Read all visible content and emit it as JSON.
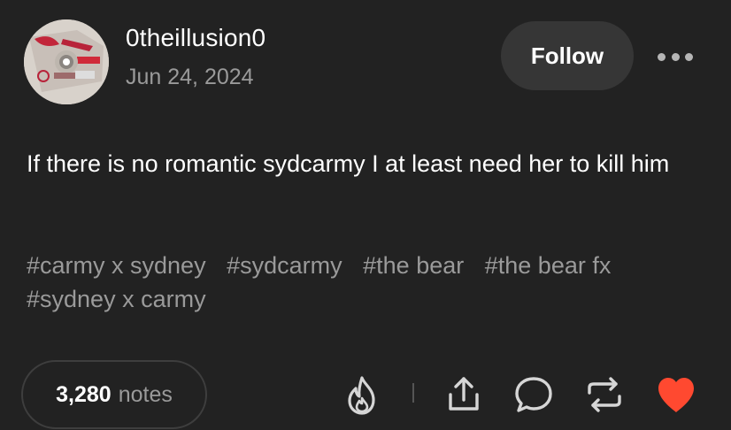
{
  "post": {
    "username": "0theillusion0",
    "date": "Jun 24, 2024",
    "follow_label": "Follow",
    "body": "If there is no romantic sydcarmy I at least need her to kill him",
    "tags": [
      "#carmy x sydney",
      "#sydcarmy",
      "#the bear",
      "#the bear fx",
      "#sydney x carmy"
    ]
  },
  "footer": {
    "notes_count": "3,280",
    "notes_label": "notes"
  },
  "icons": {
    "avatar": "cd-disc-avatar",
    "more": "more-horizontal-icon",
    "blaze": "flame-icon",
    "share": "share-icon",
    "reply": "comment-icon",
    "reblog": "reblog-icon",
    "like": "heart-icon"
  },
  "colors": {
    "background": "#222222",
    "primary_text": "#ffffff",
    "secondary_text": "#9a9a9a",
    "button_bg": "#363636",
    "like": "#ff4930"
  }
}
